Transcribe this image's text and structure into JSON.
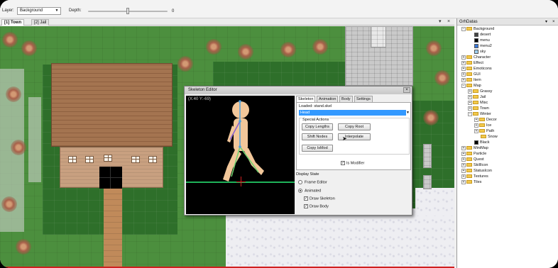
{
  "toolbar": {
    "layer_label": "Layer:",
    "layer_value": "Background",
    "depth_label": "Depth:",
    "depth_value": "0",
    "depth_slider_fraction": 0.5
  },
  "tabs": [
    {
      "label": "[1] Town",
      "active": true
    },
    {
      "label": "[2] Jail",
      "active": false
    }
  ],
  "skeleton_editor": {
    "title": "Skeleton Editor",
    "close_glyph": "×",
    "coords": "(X:40 Y:-69)",
    "tabs": [
      "Skeleton",
      "Animation",
      "Body",
      "Settings"
    ],
    "loaded_text": "Loaded: stand.skel",
    "selected_bone": "Head",
    "special_actions_label": "Special Actions",
    "buttons": {
      "copy_lengths": "Copy Lengths",
      "copy_root": "Copy Root",
      "shift_nodes": "Shift Nodes",
      "interpolate": "Interpolate",
      "copy_is_mod": "Copy IsMod"
    },
    "is_modifier_label": "Is Modifier",
    "is_modifier_checked": true,
    "display_state_label": "Display State",
    "radio_frame_editor": "Frame Editor",
    "radio_animated": "Animated",
    "animated_selected": true,
    "draw_skeleton_label": "Draw Skeleton",
    "draw_skeleton_checked": true,
    "draw_body_label": "Draw Body",
    "draw_body_checked": true
  },
  "right_panel": {
    "title": "GrhDatas",
    "pin_glyph": "▾",
    "close_glyph": "×",
    "items": [
      {
        "label": "Background",
        "level": 0,
        "expanded": true,
        "icon": "folder"
      },
      {
        "label": "desert",
        "level": 1,
        "icon": "file-dark"
      },
      {
        "label": "menu",
        "level": 1,
        "icon": "file-black"
      },
      {
        "label": "menu2",
        "level": 1,
        "icon": "file-blue"
      },
      {
        "label": "sky",
        "level": 1,
        "icon": "file-sky"
      },
      {
        "label": "Character",
        "level": 0,
        "expanded": false,
        "icon": "folder"
      },
      {
        "label": "Effect",
        "level": 0,
        "expanded": false,
        "icon": "folder"
      },
      {
        "label": "Emoticons",
        "level": 0,
        "expanded": false,
        "icon": "folder"
      },
      {
        "label": "GUI",
        "level": 0,
        "expanded": false,
        "icon": "folder"
      },
      {
        "label": "Item",
        "level": 0,
        "expanded": false,
        "icon": "folder"
      },
      {
        "label": "Map",
        "level": 0,
        "expanded": true,
        "icon": "folder"
      },
      {
        "label": "Grassy",
        "level": 1,
        "expanded": false,
        "icon": "folder"
      },
      {
        "label": "Jail",
        "level": 1,
        "expanded": false,
        "icon": "folder"
      },
      {
        "label": "Misc",
        "level": 1,
        "expanded": false,
        "icon": "folder"
      },
      {
        "label": "Town",
        "level": 1,
        "expanded": false,
        "icon": "folder"
      },
      {
        "label": "Winter",
        "level": 1,
        "expanded": true,
        "icon": "folder"
      },
      {
        "label": "Decor",
        "level": 2,
        "expanded": false,
        "icon": "folder"
      },
      {
        "label": "Ice",
        "level": 2,
        "expanded": false,
        "icon": "folder"
      },
      {
        "label": "Path",
        "level": 2,
        "expanded": false,
        "icon": "folder"
      },
      {
        "label": "Snow",
        "level": 2,
        "icon": "folder"
      },
      {
        "label": "Black",
        "level": 1,
        "icon": "file-black"
      },
      {
        "label": "MiniMap",
        "level": 0,
        "expanded": false,
        "icon": "folder"
      },
      {
        "label": "Particle",
        "level": 0,
        "expanded": false,
        "icon": "folder"
      },
      {
        "label": "Quest",
        "level": 0,
        "expanded": false,
        "icon": "folder"
      },
      {
        "label": "SkillIcon",
        "level": 0,
        "expanded": false,
        "icon": "folder"
      },
      {
        "label": "StatusIcon",
        "level": 0,
        "expanded": false,
        "icon": "folder"
      },
      {
        "label": "Textures",
        "level": 0,
        "expanded": false,
        "icon": "folder"
      },
      {
        "label": "Tiles",
        "level": 0,
        "expanded": false,
        "icon": "folder"
      }
    ]
  },
  "tab_controls": {
    "pin": "▾",
    "close": "×"
  }
}
